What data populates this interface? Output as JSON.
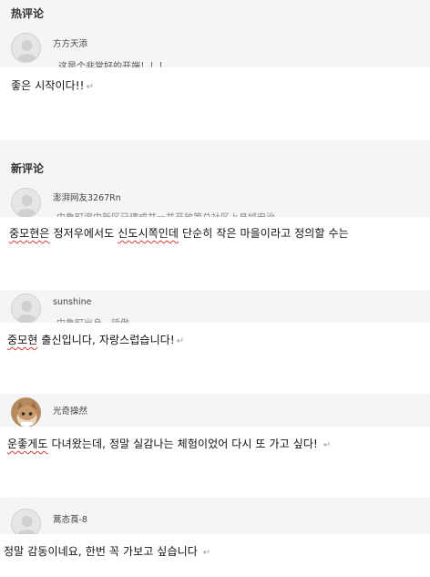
{
  "hot_section": {
    "title": "热评论",
    "comments": [
      {
        "username": "方方天添",
        "peek_text": "这是个非常好的开端！！！"
      }
    ]
  },
  "new_section": {
    "title": "新评论",
    "comments": [
      {
        "username": "澎湃网友3267Rn",
        "peek_text": "中鲁町滚中新区已建成并一并开放第总社区上县域安治"
      },
      {
        "username": "sunshine",
        "peek_text": "中鲁町出身，骄傲"
      },
      {
        "username": "光奇操然",
        "peek_text": ""
      },
      {
        "username": "蒿态莨-8",
        "peek_text": ""
      }
    ]
  },
  "translations": [
    {
      "text": "좋은 시작이다!!",
      "underlined": "",
      "rest": "좋은 시작이다!!"
    },
    {
      "underlined_1": "중모현은",
      "mid_1": " 정저우에서도 ",
      "underlined_2": "신도시쪽인데",
      "rest": " 단순히 작은 마을이라고 정의할 수는"
    },
    {
      "underlined": "중모현",
      "rest": " 출신입니다, 자랑스럽습니다!"
    },
    {
      "underlined": "운좋게도",
      "rest": " 다녀왔는데, 정말 실감나는 체험이었어 다시 또 가고 싶다! "
    },
    {
      "underlined": "",
      "rest": "정말 감동이네요, 한번 꼭 가보고 싶습니다 "
    }
  ],
  "paragraph_mark": "↵",
  "colors": {
    "band": "#f4f5f6",
    "underline": "#d23b3b"
  }
}
